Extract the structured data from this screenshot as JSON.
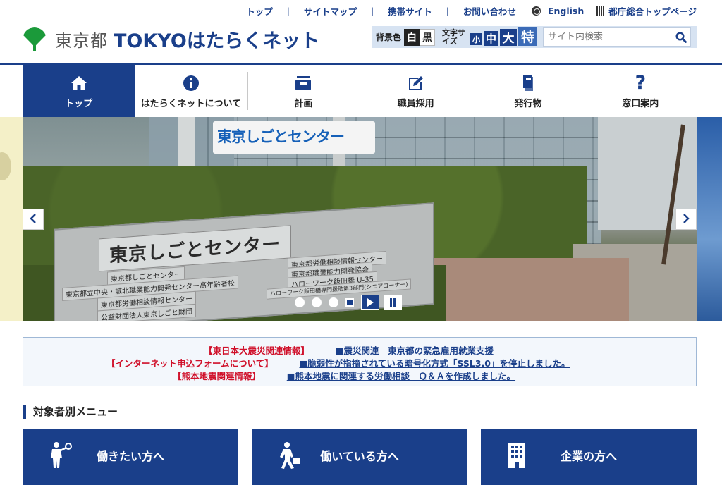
{
  "utility_links": [
    {
      "label": "トップ"
    },
    {
      "label": "サイトマップ"
    },
    {
      "label": "携帯サイト"
    },
    {
      "label": "お問い合わせ"
    }
  ],
  "english_label": "English",
  "metro_top_label": "都庁総合トップページ",
  "logo": {
    "tokyo_to": "東京都",
    "brand": "TOKYOはたらくネット"
  },
  "tools": {
    "bg_color_label": "背景色",
    "white": "白",
    "black": "黒",
    "text_size_label": "文字サイズ",
    "size_small": "小",
    "size_medium": "中",
    "size_large": "大",
    "size_xlarge": "特",
    "search_placeholder": "サイト内検索"
  },
  "global_nav": [
    {
      "label": "トップ",
      "icon": "home-icon",
      "active": true
    },
    {
      "label": "はたらくネットについて",
      "icon": "info-icon",
      "active": false
    },
    {
      "label": "計画",
      "icon": "inbox-icon",
      "active": false
    },
    {
      "label": "職員採用",
      "icon": "pen-icon",
      "active": false
    },
    {
      "label": "発行物",
      "icon": "book-icon",
      "active": false
    },
    {
      "label": "窓口案内",
      "icon": "question-icon",
      "active": false
    }
  ],
  "slider": {
    "sign_text": "東京しごとセンター",
    "building_sign": "東京しごとセンター",
    "plate_lines": [
      "東京都しごとセンター",
      "東京都立中央・城北職業能力開発センター高年齢者校",
      "東京都労働相談情報センター",
      "公益財団法人東京しごと財団",
      "東京都労働相談情報センター",
      "東京都職業能力開発協会",
      "ハローワーク飯田橋 U-35",
      "ハローワーク飯田橋専門援助第3部門(シニアコーナー)"
    ],
    "slide_count": 4,
    "current_slide": 4
  },
  "notices": [
    {
      "tag": "【東日本大震災関連情報】",
      "link": "■震災関連　東京都の緊急雇用就業支援"
    },
    {
      "tag": "【インターネット申込フォームについて】",
      "link": "■脆弱性が指摘されている暗号化方式「SSL3.0」を停止しました。"
    },
    {
      "tag": "【熊本地震関連情報】",
      "link": "■熊本地震に関連する労働相談　Ｑ＆Ａを作成しました。"
    }
  ],
  "section_title": "対象者別メニュー",
  "audience_menu": [
    {
      "label": "働きたい方へ",
      "icon": "jobseeker-icon"
    },
    {
      "label": "働いている方へ",
      "icon": "worker-icon"
    },
    {
      "label": "企業の方へ",
      "icon": "building-icon"
    }
  ],
  "colors": {
    "brand_blue": "#1a3f8a",
    "alert_red": "#d0102a",
    "ginkgo_green": "#1b9a3a"
  }
}
